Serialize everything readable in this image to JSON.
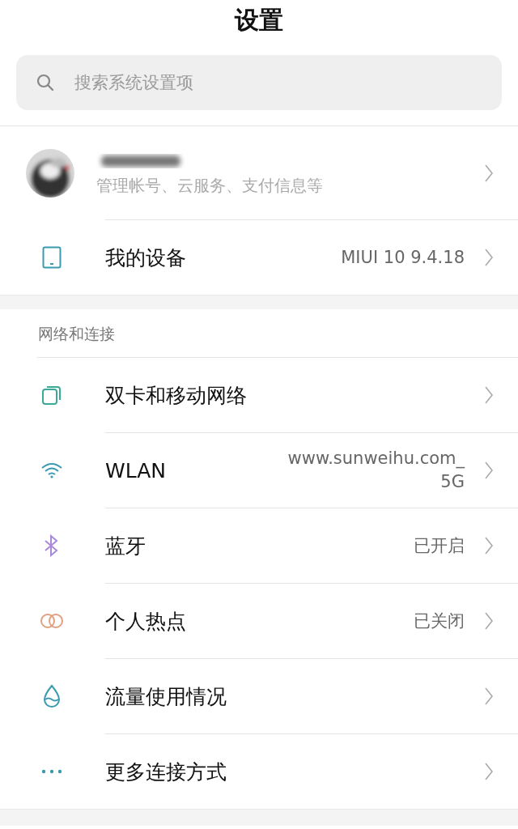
{
  "title": "设置",
  "search": {
    "placeholder": "搜索系统设置项"
  },
  "account": {
    "subtitle": "管理帐号、云服务、支付信息等"
  },
  "device": {
    "label": "我的设备",
    "value": "MIUI 10 9.4.18"
  },
  "section": {
    "header": "网络和连接",
    "items": [
      {
        "label": "双卡和移动网络"
      },
      {
        "label": "WLAN",
        "value_lines": [
          "www.sunweihu.com_",
          "5G"
        ]
      },
      {
        "label": "蓝牙",
        "value_lines": [
          "已开启"
        ]
      },
      {
        "label": "个人热点",
        "value_lines": [
          "已关闭"
        ]
      },
      {
        "label": "流量使用情况"
      },
      {
        "label": "更多连接方式"
      }
    ]
  }
}
